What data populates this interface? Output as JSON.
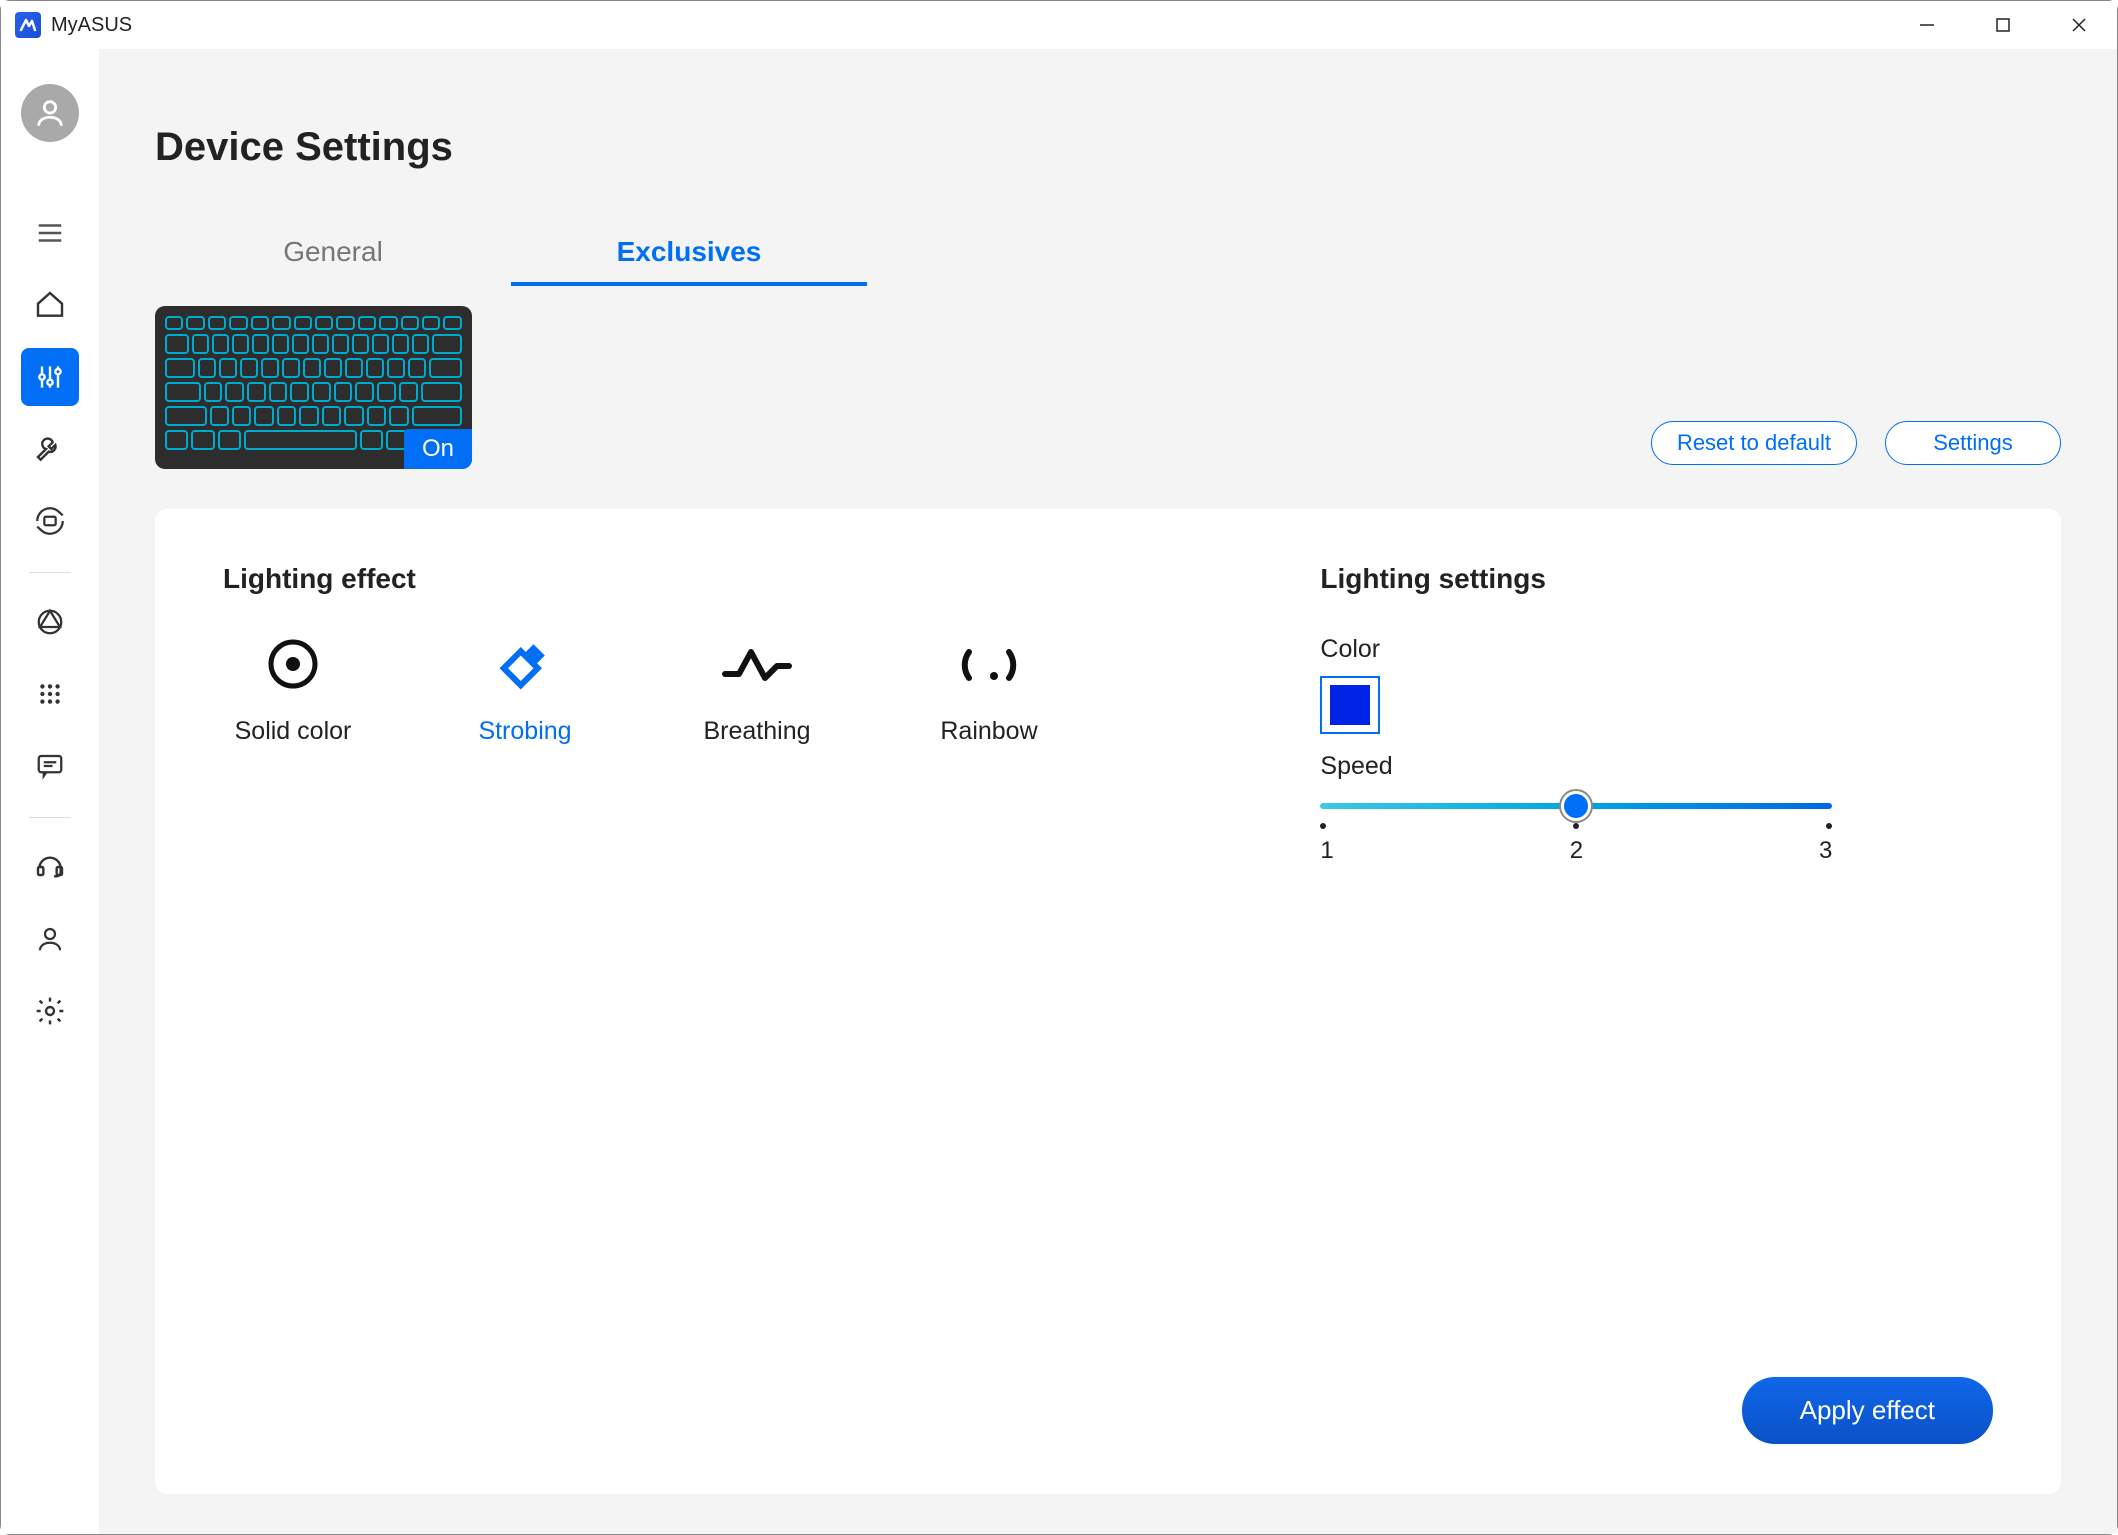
{
  "app": {
    "title": "MyASUS"
  },
  "page": {
    "title": "Device Settings"
  },
  "tabs": [
    {
      "label": "General",
      "active": false
    },
    {
      "label": "Exclusives",
      "active": true
    }
  ],
  "keyboard_preview": {
    "badge": "On"
  },
  "actions": {
    "reset_label": "Reset to default",
    "settings_label": "Settings"
  },
  "lighting_effect": {
    "title": "Lighting effect",
    "options": [
      {
        "label": "Solid color",
        "active": false
      },
      {
        "label": "Strobing",
        "active": true
      },
      {
        "label": "Breathing",
        "active": false
      },
      {
        "label": "Rainbow",
        "active": false
      }
    ]
  },
  "lighting_settings": {
    "title": "Lighting settings",
    "color_label": "Color",
    "color_value": "#0023e5",
    "speed_label": "Speed",
    "speed_value": 2,
    "speed_ticks": [
      "1",
      "2",
      "3"
    ]
  },
  "apply_label": "Apply effect"
}
